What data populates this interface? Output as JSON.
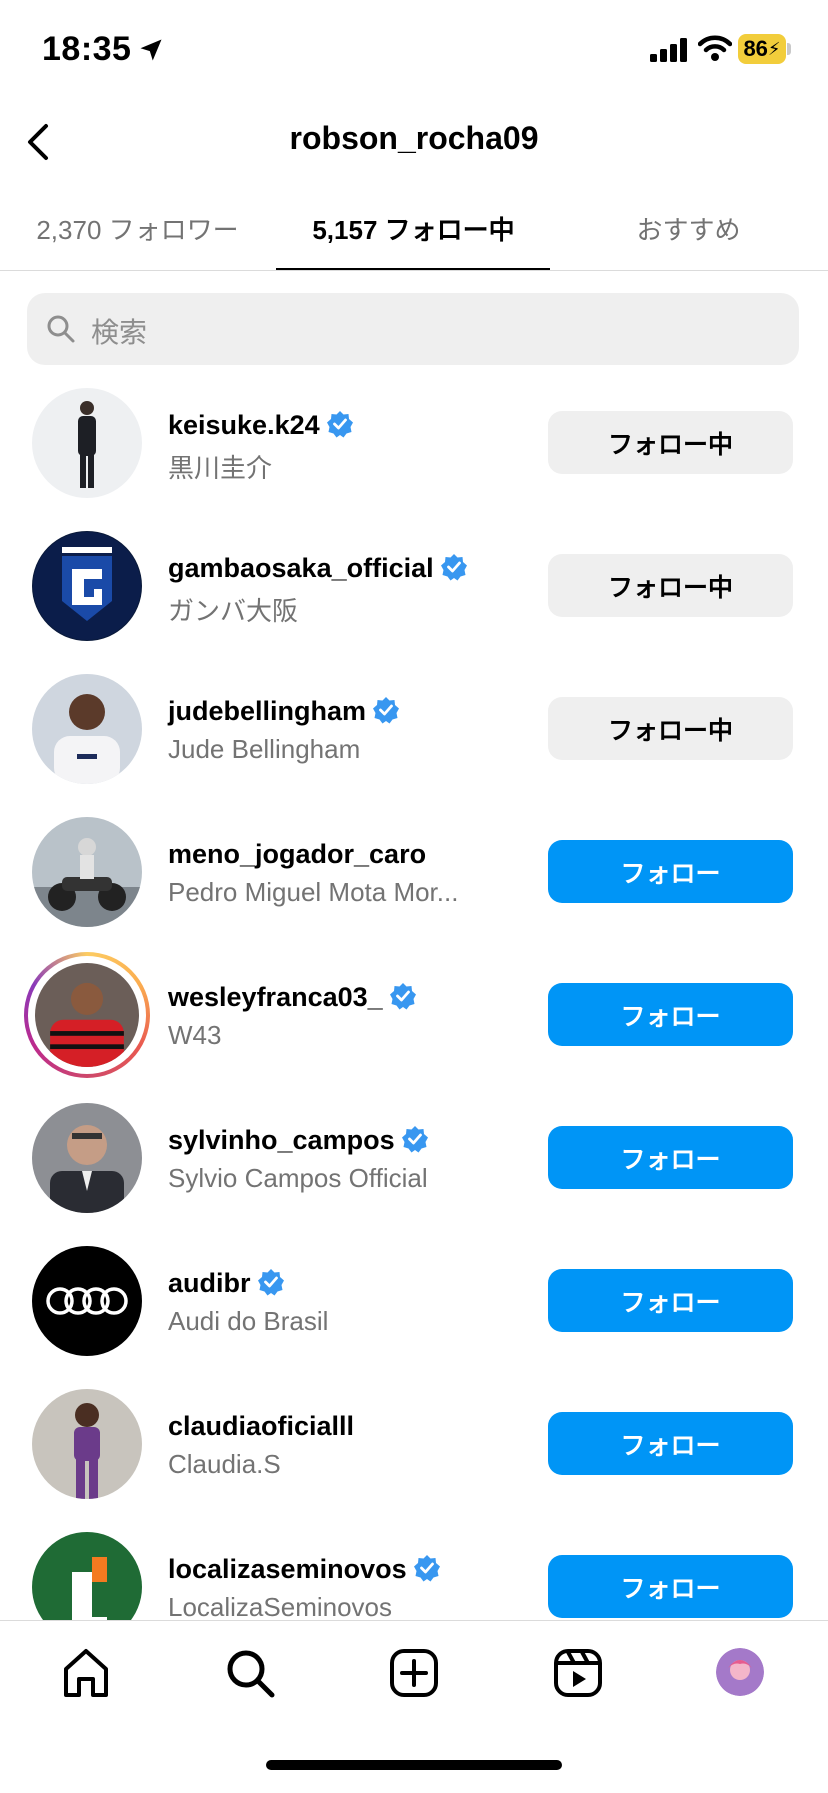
{
  "status_bar": {
    "time": "18:35",
    "battery": "86"
  },
  "header": {
    "title": "robson_rocha09"
  },
  "tabs": [
    {
      "label": "2,370 フォロワー"
    },
    {
      "label": "5,157 フォロー中"
    },
    {
      "label": "おすすめ"
    }
  ],
  "search": {
    "placeholder": "検索"
  },
  "users": [
    {
      "username": "keisuke.k24",
      "name": "黒川圭介",
      "verified": true,
      "button": "フォロー中"
    },
    {
      "username": "gambaosaka_official",
      "name": "ガンバ大阪",
      "verified": true,
      "button": "フォロー中"
    },
    {
      "username": "judebellingham",
      "name": "Jude Bellingham",
      "verified": true,
      "button": "フォロー中"
    },
    {
      "username": "meno_jogador_caro",
      "name": "Pedro Miguel Mota Mor...",
      "verified": false,
      "button": "フォロー"
    },
    {
      "username": "wesleyfranca03_",
      "name": "W43",
      "verified": true,
      "button": "フォロー"
    },
    {
      "username": "sylvinho_campos",
      "name": "Sylvio Campos Official",
      "verified": true,
      "button": "フォロー"
    },
    {
      "username": "audibr",
      "name": "Audi do Brasil",
      "verified": true,
      "button": "フォロー"
    },
    {
      "username": "claudiaoficialll",
      "name": "Claudia.S",
      "verified": false,
      "button": "フォロー"
    },
    {
      "username": "localizaseminovos",
      "name": "LocalizaSeminovos",
      "verified": true,
      "button": "フォロー"
    }
  ],
  "colors": {
    "follow_blue": "#0095f6",
    "following_grey": "#efefef",
    "verified_blue": "#3897f0"
  }
}
